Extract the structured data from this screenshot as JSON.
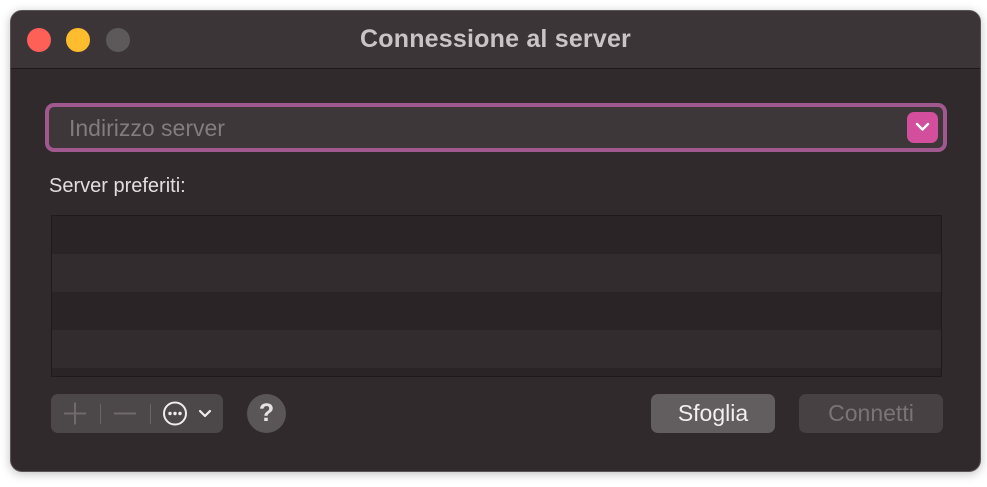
{
  "window": {
    "title": "Connessione al server"
  },
  "address_field": {
    "value": "",
    "placeholder": "Indirizzo server"
  },
  "favorites": {
    "label": "Server preferiti:",
    "items": []
  },
  "toolbar": {
    "add_icon": "plus-icon",
    "remove_icon": "minus-icon",
    "more_icon": "ellipsis-circle-icon",
    "help_label": "?"
  },
  "buttons": {
    "browse_label": "Sfoglia",
    "connect_label": "Connetti"
  },
  "colors": {
    "accent": "#d34e9c",
    "focus_ring": "#a0588f"
  }
}
